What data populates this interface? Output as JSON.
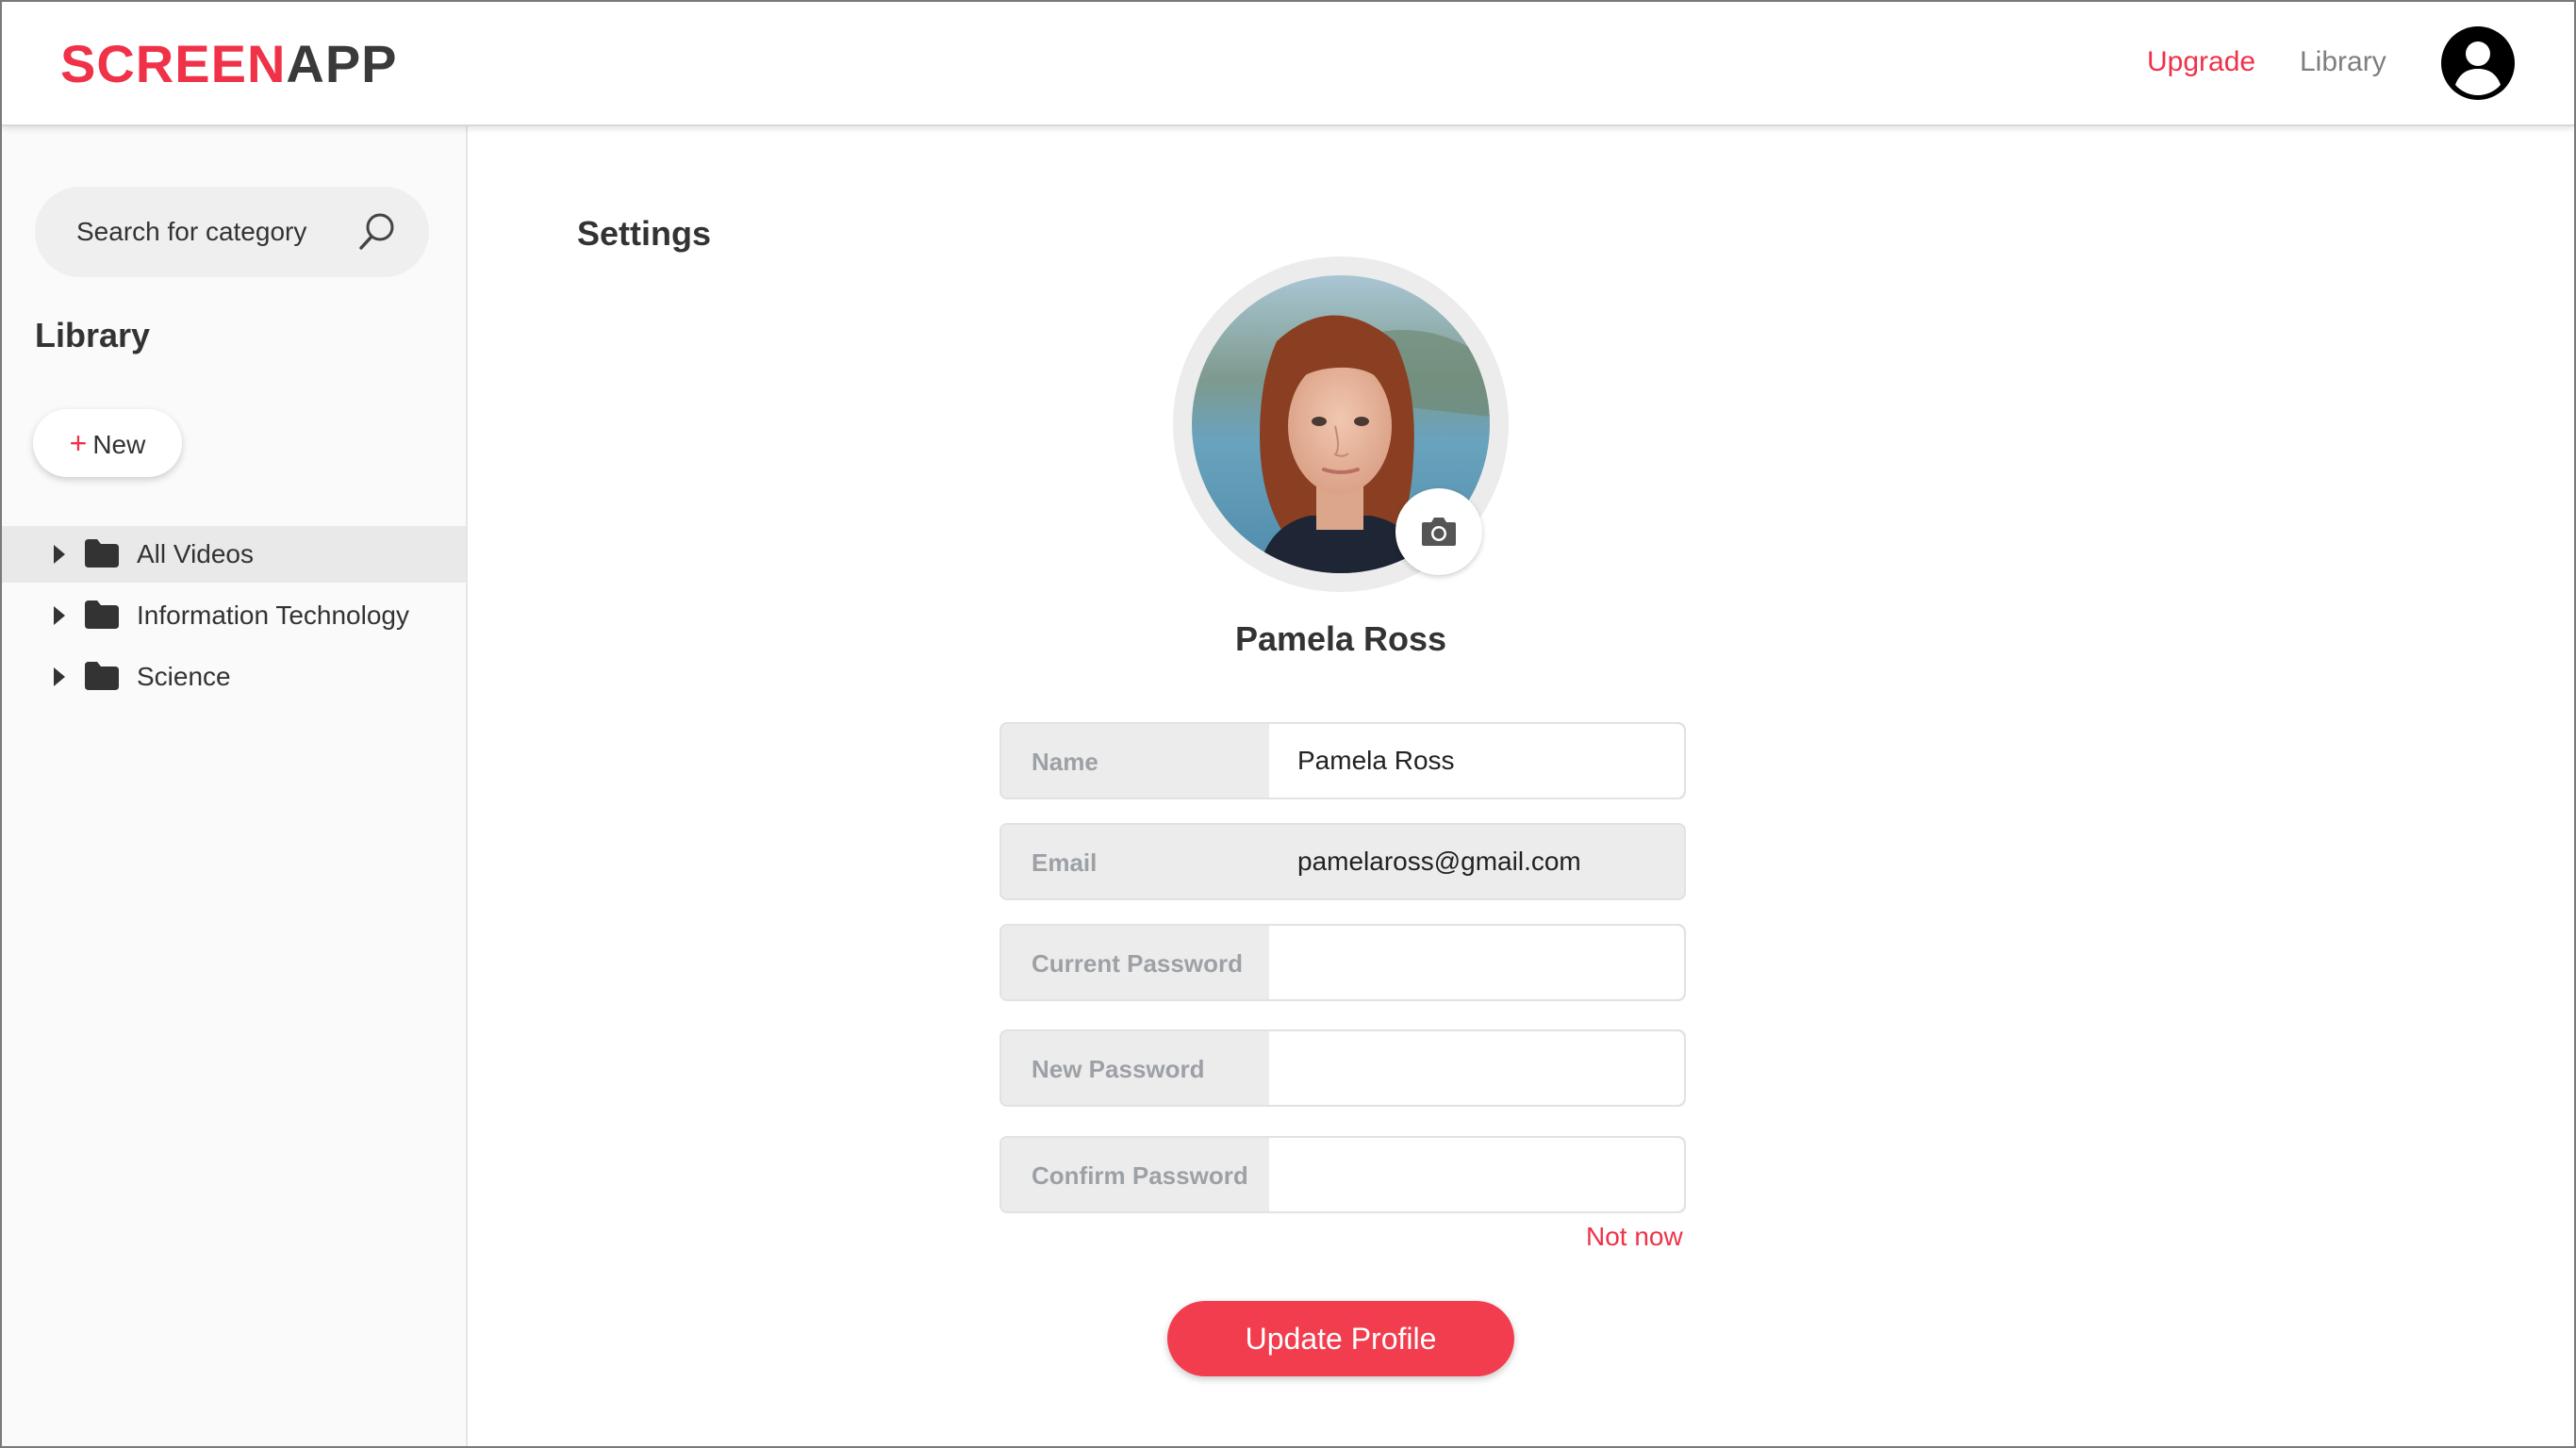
{
  "header": {
    "logo_part1": "SCREEN",
    "logo_part2": "APP",
    "nav_upgrade": "Upgrade",
    "nav_library": "Library",
    "account_icon": "user-circle-icon"
  },
  "sidebar": {
    "search": {
      "placeholder": "Search for category",
      "icon": "search-icon"
    },
    "title": "Library",
    "new_button": {
      "plus": "+",
      "label": "New"
    },
    "items": [
      {
        "label": "All Videos",
        "active": true,
        "icon": "folder-icon"
      },
      {
        "label": "Information Technology",
        "active": false,
        "icon": "folder-icon"
      },
      {
        "label": "Science",
        "active": false,
        "icon": "folder-icon"
      }
    ]
  },
  "main": {
    "title": "Settings",
    "profile": {
      "name": "Pamela Ross",
      "camera_icon": "camera-icon"
    },
    "form": {
      "name": {
        "label": "Name",
        "value": "Pamela Ross"
      },
      "email": {
        "label": "Email",
        "value": "pamelaross@gmail.com"
      },
      "current_password": {
        "label": "Current Password",
        "value": ""
      },
      "new_password": {
        "label": "New Password",
        "value": ""
      },
      "confirm_password": {
        "label": "Confirm Password",
        "value": ""
      }
    },
    "not_now": "Not now",
    "update_button": "Update Profile"
  },
  "colors": {
    "accent": "#ef3248",
    "button": "#f23d4f",
    "muted_label": "#9da1a6"
  }
}
